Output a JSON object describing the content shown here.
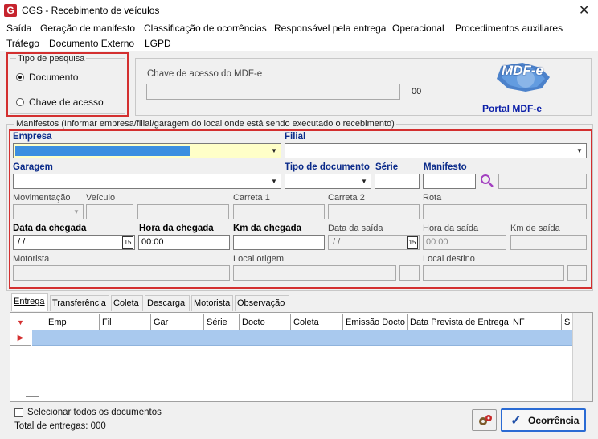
{
  "window": {
    "title": "CGS - Recebimento de veículos",
    "app_icon": "G"
  },
  "menu": {
    "row1": [
      "Saída",
      "Geração de manifesto",
      "Classificação de ocorrências",
      "Responsável pela entrega",
      "Operacional",
      "Procedimentos auxiliares"
    ],
    "row2": [
      "Tráfego",
      "Documento Externo",
      "LGPD"
    ]
  },
  "tipo_pesquisa": {
    "legend": "Tipo de pesquisa",
    "options": [
      "Documento",
      "Chave de acesso"
    ],
    "selected": "Documento"
  },
  "chave": {
    "label": "Chave de acesso do MDF-e",
    "value": "",
    "count": "00"
  },
  "portal": {
    "logo_text": "MDF-e",
    "link": "Portal MDF-e"
  },
  "manifestos": {
    "legend": "Manifestos (Informar empresa/filial/garagem do local onde está sendo executado o recebimento)",
    "labels": {
      "empresa": "Empresa",
      "filial": "Filial",
      "garagem": "Garagem",
      "tipo_documento": "Tipo de documento",
      "serie": "Série",
      "manifesto": "Manifesto",
      "movimentacao": "Movimentação",
      "veiculo": "Veículo",
      "carreta1": "Carreta 1",
      "carreta2": "Carreta 2",
      "rota": "Rota",
      "data_chegada": "Data da chegada",
      "hora_chegada": "Hora da chegada",
      "km_chegada": "Km da chegada",
      "data_saida": "Data da saída",
      "hora_saida": "Hora da saída",
      "km_saida": "Km de saída",
      "motorista": "Motorista",
      "local_origem": "Local origem",
      "local_destino": "Local destino"
    },
    "values": {
      "data_chegada": " / /",
      "hora_chegada": "00:00",
      "data_saida": " / /",
      "hora_saida": "00:00",
      "calendar_day": "15"
    }
  },
  "tabs": [
    "Entrega",
    "Transferência",
    "Coleta",
    "Descarga",
    "Motorista",
    "Observação"
  ],
  "grid": {
    "columns": [
      "Emp",
      "Fil",
      "Gar",
      "Série",
      "Docto",
      "Coleta",
      "Emissão Docto",
      "Data Prevista de Entrega",
      "NF",
      "S"
    ]
  },
  "footer": {
    "select_all": "Selecionar todos os documentos",
    "total": "Total de entregas: 000",
    "ocorrencia_button": "Ocorrência"
  },
  "colors": {
    "highlight_red": "#d32f2f",
    "selection_blue": "#3c8fe0",
    "row_selected": "#a9c9ee",
    "label_blue": "#0b2b8a"
  }
}
